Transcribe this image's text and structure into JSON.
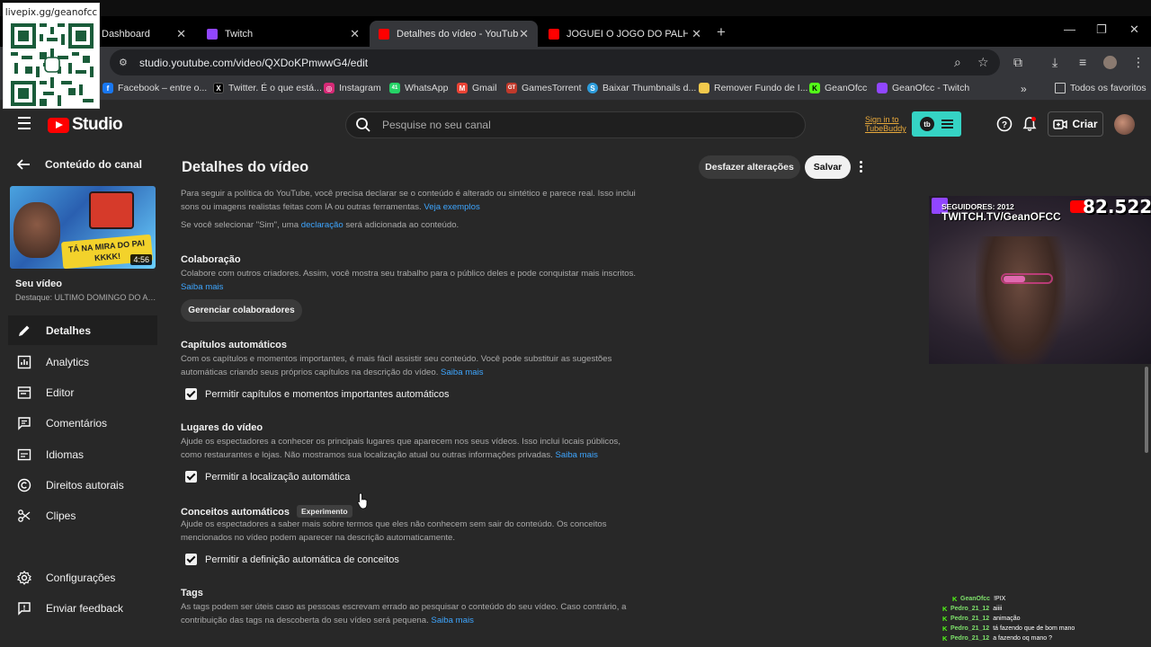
{
  "overlay": {
    "qr_label": "livepix.gg/geanofcc",
    "webcam": {
      "followers_label": "SEGUIDORES: 2012",
      "channel": "TWITCH.TV/GeanOFCC",
      "youtube_count": "82.522"
    },
    "chat": [
      {
        "user": "GeanOfcc",
        "message": "!PIX"
      },
      {
        "user": "Pedro_21_12",
        "message": "aiiii"
      },
      {
        "user": "Pedro_21_12",
        "message": "animação"
      },
      {
        "user": "Pedro_21_12",
        "message": "tá fazendo que de bom mano"
      },
      {
        "user": "Pedro_21_12",
        "message": "a fazendo oq mano ?"
      }
    ]
  },
  "browser": {
    "tabs": [
      {
        "title": "Dashboard",
        "favicon_color": "#000000"
      },
      {
        "title": "Twitch",
        "favicon_color": "#9146ff"
      },
      {
        "title": "Detalhes do vídeo - YouTube St",
        "favicon_color": "#ff0000",
        "active": true
      },
      {
        "title": "JOGUEI O JOGO DO PALHAÇO",
        "favicon_color": "#ff0000"
      }
    ],
    "url": "studio.youtube.com/video/QXDoKPmwwG4/edit",
    "bookmarks": [
      {
        "label": "Facebook – entre o...",
        "icon_color": "#1877f2",
        "glyph": "f"
      },
      {
        "label": "Twitter. É o que está...",
        "icon_color": "#000000",
        "glyph": "X"
      },
      {
        "label": "Instagram",
        "icon_color": "#d62976",
        "glyph": "◎"
      },
      {
        "label": "WhatsApp",
        "icon_color": "#25d366",
        "glyph": "41"
      },
      {
        "label": "Gmail",
        "icon_color": "#ea4335",
        "glyph": "M"
      },
      {
        "label": "GamesTorrent",
        "icon_color": "#c0392b",
        "glyph": "GT"
      },
      {
        "label": "Baixar Thumbnails d...",
        "icon_color": "#2d9cdb",
        "glyph": "S"
      },
      {
        "label": "Remover Fundo de I...",
        "icon_color": "#f2c94c",
        "glyph": "■"
      },
      {
        "label": "GeanOfcc",
        "icon_color": "#53fc18",
        "glyph": "K"
      },
      {
        "label": "GeanOfcc - Twitch",
        "icon_color": "#9146ff",
        "glyph": "▣"
      }
    ],
    "all_bookmarks": "Todos os favoritos"
  },
  "header": {
    "logo_text": "Studio",
    "search_placeholder": "Pesquise no seu canal",
    "tubebuddy_signin": "Sign in to TubeBuddy",
    "create_label": "Criar"
  },
  "sidebar": {
    "back_label": "Conteúdo do canal",
    "thumb_banner": "TÁ NA MIRA DO PAI KKKK!",
    "thumb_duration": "4:56",
    "your_video": "Seu vídeo",
    "featured": "Destaque: ULTIMO DOMINGO DO AN...",
    "items": [
      {
        "label": "Detalhes",
        "icon": "pencil-icon",
        "active": true
      },
      {
        "label": "Analytics",
        "icon": "analytics-icon"
      },
      {
        "label": "Editor",
        "icon": "editor-icon"
      },
      {
        "label": "Comentários",
        "icon": "comments-icon"
      },
      {
        "label": "Idiomas",
        "icon": "subtitles-icon"
      },
      {
        "label": "Direitos autorais",
        "icon": "copyright-icon"
      },
      {
        "label": "Clipes",
        "icon": "scissors-icon"
      }
    ],
    "settings": "Configurações",
    "feedback": "Enviar feedback"
  },
  "main": {
    "title": "Detalhes do vídeo",
    "undo_label": "Desfazer alterações",
    "save_label": "Salvar",
    "altered_text": "Para seguir a política do YouTube, você precisa declarar se o conteúdo é alterado ou sintético e parece real. Isso inclui sons ou imagens realistas feitas com IA ou outras ferramentas.",
    "altered_link": "Veja exemplos",
    "declaration_prefix": "Se você selecionar \"Sim\", uma",
    "declaration_link": "declaração",
    "declaration_suffix": "será adicionada ao conteúdo.",
    "collab": {
      "title": "Colaboração",
      "text": "Colabore com outros criadores. Assim, você mostra seu trabalho para o público deles e pode conquistar mais inscritos.",
      "link": "Saiba mais",
      "button": "Gerenciar colaboradores"
    },
    "chapters": {
      "title": "Capítulos automáticos",
      "text": "Com os capítulos e momentos importantes, é mais fácil assistir seu conteúdo. Você pode substituir as sugestões automáticas criando seus próprios capítulos na descrição do vídeo.",
      "link": "Saiba mais",
      "checkbox": "Permitir capítulos e momentos importantes automáticos"
    },
    "places": {
      "title": "Lugares do vídeo",
      "text": "Ajude os espectadores a conhecer os principais lugares que aparecem nos seus vídeos. Isso inclui locais públicos, como restaurantes e lojas. Não mostramos sua localização atual ou outras informações privadas.",
      "link": "Saiba mais",
      "checkbox": "Permitir a localização automática"
    },
    "concepts": {
      "title": "Conceitos automáticos",
      "badge": "Experimento",
      "text": "Ajude os espectadores a saber mais sobre termos que eles não conhecem sem sair do conteúdo. Os conceitos mencionados no vídeo podem aparecer na descrição automaticamente.",
      "checkbox": "Permitir a definição automática de conceitos"
    },
    "tags": {
      "title": "Tags",
      "text": "As tags podem ser úteis caso as pessoas escrevam errado ao pesquisar o conteúdo do seu vídeo. Caso contrário, a contribuição das tags na descoberta do seu vídeo será pequena.",
      "link": "Saiba mais"
    }
  }
}
